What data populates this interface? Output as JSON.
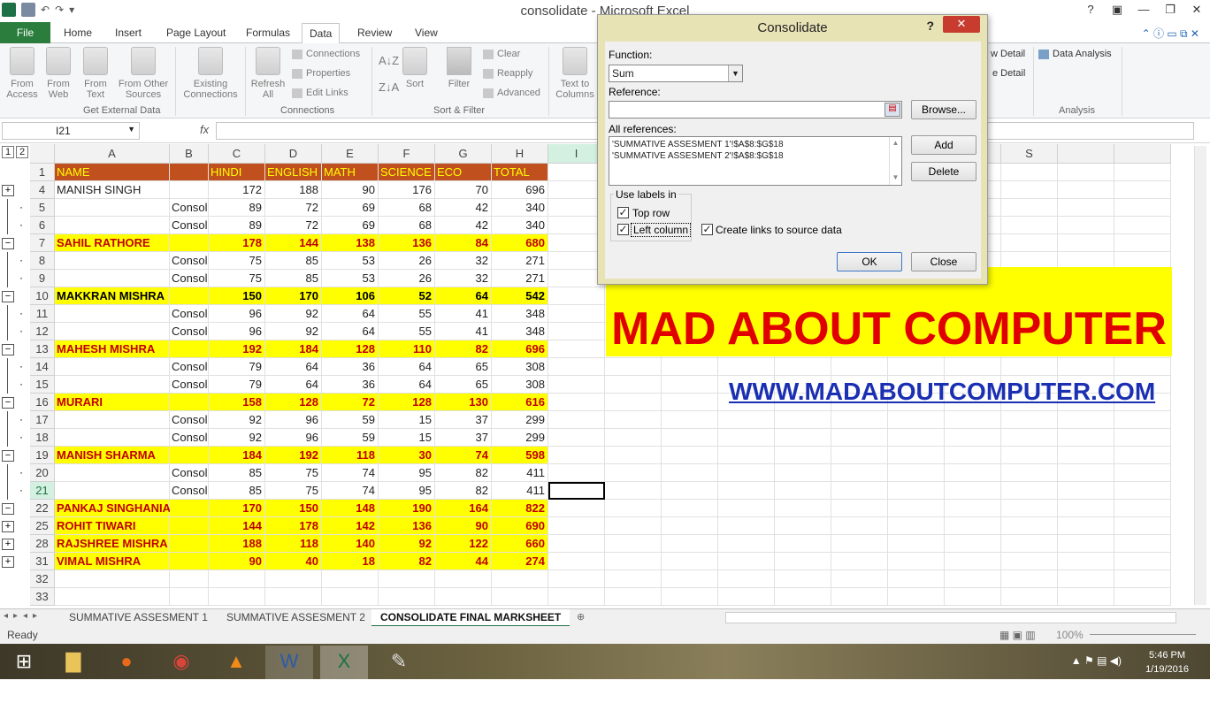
{
  "app": {
    "title": "consolidate - Microsoft Excel"
  },
  "tabs": [
    "File",
    "Home",
    "Insert",
    "Page Layout",
    "Formulas",
    "Data",
    "Review",
    "View"
  ],
  "ribbon": {
    "get_external": {
      "buttons": [
        "From\nAccess",
        "From\nWeb",
        "From\nText",
        "From Other\nSources"
      ],
      "existing": "Existing\nConnections",
      "label": "Get External Data"
    },
    "connections": {
      "refresh": "Refresh\nAll",
      "items": [
        "Connections",
        "Properties",
        "Edit Links"
      ],
      "label": "Connections"
    },
    "sort_filter": {
      "sort": "Sort",
      "filter": "Filter",
      "items": [
        "Clear",
        "Reapply",
        "Advanced"
      ],
      "label": "Sort & Filter"
    },
    "text_to_columns": "Text to\nColumns",
    "outline_partial": [
      "w Detail",
      "e Detail"
    ],
    "analysis": {
      "item": "Data Analysis",
      "label": "Analysis"
    }
  },
  "formula_bar": {
    "name_box": "I21",
    "fx": "fx",
    "value": ""
  },
  "columns": [
    "A",
    "B",
    "C",
    "D",
    "E",
    "F",
    "G",
    "H",
    "I",
    "",
    "",
    "",
    "",
    "",
    "Q",
    "R",
    "S"
  ],
  "header_row": {
    "row": "1",
    "cells": [
      "NAME",
      "",
      "HINDI",
      "ENGLISH",
      "MATH",
      "SCIENCE",
      "ECO",
      "TOTAL"
    ]
  },
  "rows": [
    {
      "row": "4",
      "type": "plus",
      "bold": false,
      "a": "MANISH SINGH",
      "b": "",
      "c": "172",
      "d": "188",
      "e": "90",
      "f": "176",
      "g": "70",
      "h": "696"
    },
    {
      "row": "5",
      "type": "dot",
      "a": "",
      "b": "Consol",
      "c": "89",
      "d": "72",
      "e": "69",
      "f": "68",
      "g": "42",
      "h": "340"
    },
    {
      "row": "6",
      "type": "dot",
      "a": "",
      "b": "Consol",
      "c": "89",
      "d": "72",
      "e": "69",
      "f": "68",
      "g": "42",
      "h": "340"
    },
    {
      "row": "7",
      "type": "minus",
      "a": "SAHIL RATHORE",
      "b": "",
      "c": "178",
      "d": "144",
      "e": "138",
      "f": "136",
      "g": "84",
      "h": "680",
      "color": "red"
    },
    {
      "row": "8",
      "type": "dot",
      "a": "",
      "b": "Consol",
      "c": "75",
      "d": "85",
      "e": "53",
      "f": "26",
      "g": "32",
      "h": "271"
    },
    {
      "row": "9",
      "type": "dot",
      "a": "",
      "b": "Consol",
      "c": "75",
      "d": "85",
      "e": "53",
      "f": "26",
      "g": "32",
      "h": "271"
    },
    {
      "row": "10",
      "type": "minus",
      "a": "MAKKRAN MISHRA",
      "b": "",
      "c": "150",
      "d": "170",
      "e": "106",
      "f": "52",
      "g": "64",
      "h": "542",
      "color": "black"
    },
    {
      "row": "11",
      "type": "dot",
      "a": "",
      "b": "Consol",
      "c": "96",
      "d": "92",
      "e": "64",
      "f": "55",
      "g": "41",
      "h": "348"
    },
    {
      "row": "12",
      "type": "dot",
      "a": "",
      "b": "Consol",
      "c": "96",
      "d": "92",
      "e": "64",
      "f": "55",
      "g": "41",
      "h": "348"
    },
    {
      "row": "13",
      "type": "minus",
      "a": "MAHESH MISHRA",
      "b": "",
      "c": "192",
      "d": "184",
      "e": "128",
      "f": "110",
      "g": "82",
      "h": "696",
      "color": "red"
    },
    {
      "row": "14",
      "type": "dot",
      "a": "",
      "b": "Consol",
      "c": "79",
      "d": "64",
      "e": "36",
      "f": "64",
      "g": "65",
      "h": "308"
    },
    {
      "row": "15",
      "type": "dot",
      "a": "",
      "b": "Consol",
      "c": "79",
      "d": "64",
      "e": "36",
      "f": "64",
      "g": "65",
      "h": "308"
    },
    {
      "row": "16",
      "type": "minus",
      "a": "MURARI",
      "b": "",
      "c": "158",
      "d": "128",
      "e": "72",
      "f": "128",
      "g": "130",
      "h": "616",
      "color": "red"
    },
    {
      "row": "17",
      "type": "dot",
      "a": "",
      "b": "Consol",
      "c": "92",
      "d": "96",
      "e": "59",
      "f": "15",
      "g": "37",
      "h": "299"
    },
    {
      "row": "18",
      "type": "dot",
      "a": "",
      "b": "Consol",
      "c": "92",
      "d": "96",
      "e": "59",
      "f": "15",
      "g": "37",
      "h": "299"
    },
    {
      "row": "19",
      "type": "minus",
      "a": "MANISH SHARMA",
      "b": "",
      "c": "184",
      "d": "192",
      "e": "118",
      "f": "30",
      "g": "74",
      "h": "598",
      "color": "red"
    },
    {
      "row": "20",
      "type": "dot",
      "a": "",
      "b": "Consol",
      "c": "85",
      "d": "75",
      "e": "74",
      "f": "95",
      "g": "82",
      "h": "411"
    },
    {
      "row": "21",
      "type": "dot",
      "a": "",
      "b": "Consol",
      "c": "85",
      "d": "75",
      "e": "74",
      "f": "95",
      "g": "82",
      "h": "411"
    },
    {
      "row": "22",
      "type": "minus",
      "a": "PANKAJ SINGHANIA",
      "b": "",
      "c": "170",
      "d": "150",
      "e": "148",
      "f": "190",
      "g": "164",
      "h": "822",
      "color": "red"
    },
    {
      "row": "25",
      "type": "plusy",
      "a": "ROHIT TIWARI",
      "b": "",
      "c": "144",
      "d": "178",
      "e": "142",
      "f": "136",
      "g": "90",
      "h": "690",
      "color": "red"
    },
    {
      "row": "28",
      "type": "plusy",
      "a": "RAJSHREE MISHRA",
      "b": "",
      "c": "188",
      "d": "118",
      "e": "140",
      "f": "92",
      "g": "122",
      "h": "660",
      "color": "red"
    },
    {
      "row": "31",
      "type": "plusy",
      "a": "VIMAL MISHRA",
      "b": "",
      "c": "90",
      "d": "40",
      "e": "18",
      "f": "82",
      "g": "44",
      "h": "274",
      "color": "red"
    },
    {
      "row": "32",
      "type": "empty"
    },
    {
      "row": "33",
      "type": "empty"
    }
  ],
  "outline_levels": [
    "1",
    "2"
  ],
  "banner": {
    "text": "MAD ABOUT COMPUTER",
    "url": "WWW.MADABOUTCOMPUTER.COM"
  },
  "dialog": {
    "title": "Consolidate",
    "help": "?",
    "close_x": "✕",
    "function_label": "Function:",
    "function_value": "Sum",
    "reference_label": "Reference:",
    "reference_value": "",
    "browse": "Browse...",
    "all_refs_label": "All references:",
    "all_refs": [
      "'SUMMATIVE ASSESMENT 1'!$A$8:$G$18",
      "'SUMMATIVE ASSESMENT 2'!$A$8:$G$18"
    ],
    "add": "Add",
    "delete": "Delete",
    "use_labels": "Use labels in",
    "top_row": "Top row",
    "left_column": "Left column",
    "create_links": "Create links to source data",
    "ok": "OK",
    "close": "Close"
  },
  "sheets": [
    "SUMMATIVE ASSESMENT 1",
    "SUMMATIVE ASSESMENT 2",
    "CONSOLIDATE FINAL MARKSHEET"
  ],
  "active_sheet": 2,
  "status": {
    "ready": "Ready",
    "zoom": "100%"
  },
  "taskbar": {
    "time": "5:46 PM",
    "date": "1/19/2016"
  }
}
